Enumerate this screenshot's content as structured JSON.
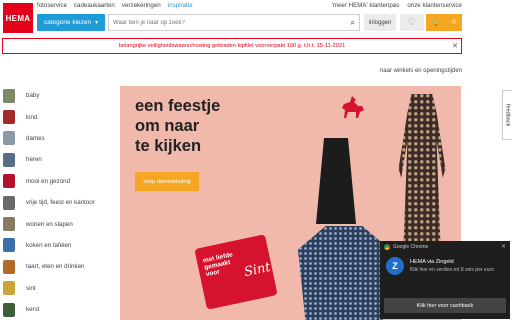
{
  "header": {
    "logo": "HEMA",
    "nav": [
      "fotoservice",
      "cadeaukaarten",
      "verzekeringen",
      "inspiratie"
    ],
    "toplinks": [
      "'meer HEMA' klantenpas",
      "onze klantenservice"
    ],
    "category_button": "categorie kiezen",
    "search_placeholder": "Waar ben je naar op zoek?",
    "login_label": "inloggen",
    "cart_count": "0"
  },
  "alert": {
    "text": "belangrijke veiligheidswaarschuwing gebraden kipfilet voorverpakt 100 g. t.h.t. 15-11-2021"
  },
  "store_link": "naar winkels en openingstijden",
  "sidebar": {
    "items": [
      {
        "label": "baby",
        "color": "#7c8a68"
      },
      {
        "label": "kind",
        "color": "#a22a2a"
      },
      {
        "label": "dames",
        "color": "#8a9aa8"
      },
      {
        "label": "heren",
        "color": "#5a6d86"
      },
      {
        "label": "mooi en gezond",
        "color": "#b3122f"
      },
      {
        "label": "vrije tijd, feest en kantoor",
        "color": "#6a6a6a"
      },
      {
        "label": "wonen en slapen",
        "color": "#8a7a62"
      },
      {
        "label": "koken en tafelen",
        "color": "#3c6ea8"
      },
      {
        "label": "taart, eten en drinken",
        "color": "#b06a2a"
      },
      {
        "label": "sint",
        "color": "#c8a43a"
      },
      {
        "label": "kerst",
        "color": "#3e5e3a"
      }
    ]
  },
  "banner": {
    "line1": "een feestje",
    "line2": "om naar",
    "line3": "te kijken",
    "cta": "shop damesk­leding",
    "tag_text_1": "met liefde",
    "tag_text_2": "gemaakt",
    "tag_text_3": "voor",
    "tag_script": "Sint"
  },
  "feedback_label": "feedback",
  "notification": {
    "app": "Google Chrome",
    "title": "HEMA via Zingeld",
    "text": "Klik hier en verdien tot 8 zeis per euro",
    "action": "Klik hier voor cashback",
    "icon_letter": "Z"
  }
}
